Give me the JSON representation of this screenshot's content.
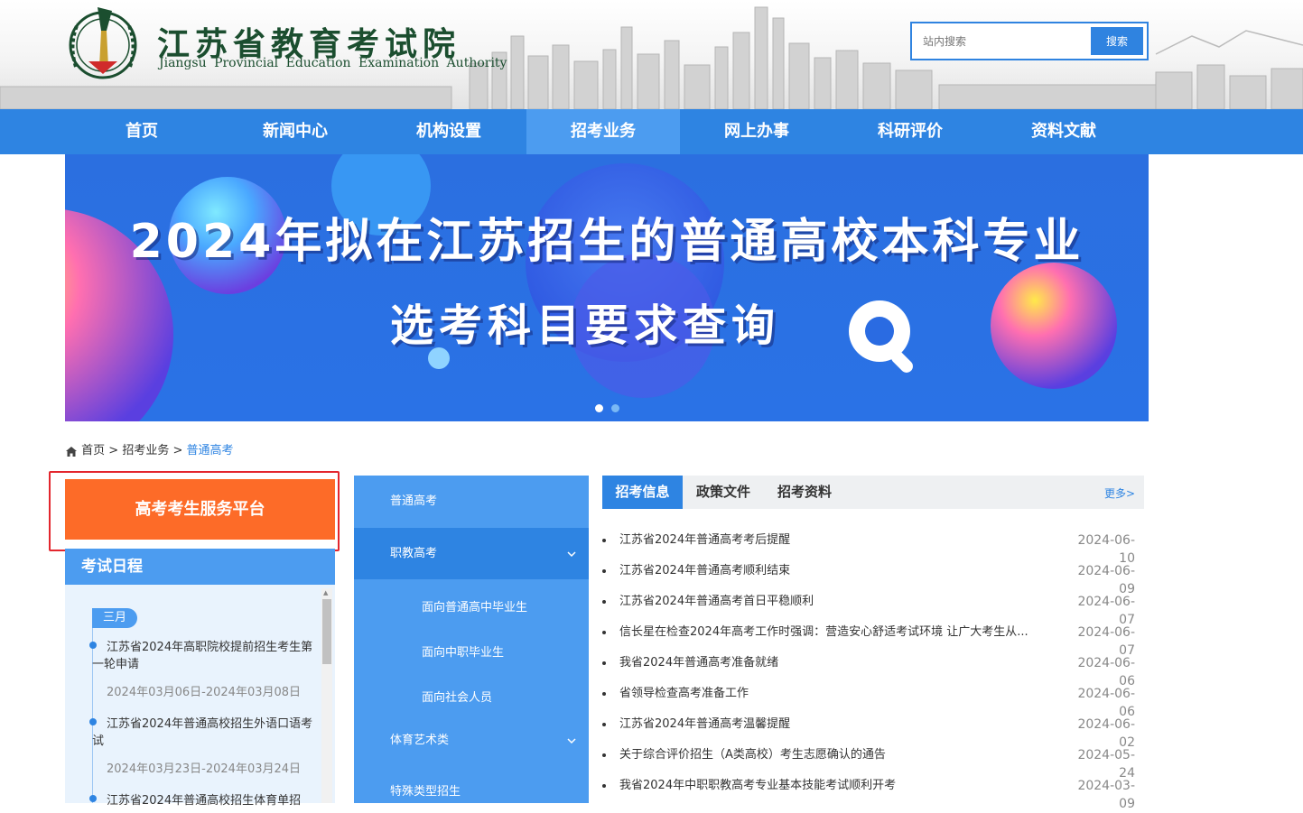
{
  "header": {
    "title": "江苏省教育考试院",
    "subtitle": "Jiangsu Provincial Education Examination Authority",
    "search_placeholder": "站内搜索",
    "search_button": "搜索"
  },
  "nav": {
    "items": [
      "首页",
      "新闻中心",
      "机构设置",
      "招考业务",
      "网上办事",
      "科研评价",
      "资料文献"
    ],
    "active": "招考业务"
  },
  "banner": {
    "line1": "2024年拟在江苏招生的普通高校本科专业",
    "line2": "选考科目要求查询",
    "slide_count": 2,
    "active_slide": 1
  },
  "breadcrumb": {
    "items": [
      "首页",
      "招考业务",
      "普通高考"
    ],
    "separator": ">"
  },
  "left": {
    "platform_button": "高考考生服务平台",
    "schedule_title": "考试日程",
    "month": "三月",
    "events": [
      {
        "title": "江苏省2024年高职院校提前招生考生第一轮申请",
        "date": "2024年03月06日-2024年03月08日"
      },
      {
        "title": "江苏省2024年普通高校招生外语口语考试",
        "date": "2024年03月23日-2024年03月24日"
      },
      {
        "title": "江苏省2024年普通高校招生体育单招",
        "date": ""
      }
    ]
  },
  "middle": {
    "menu": [
      {
        "label": "普通高考"
      },
      {
        "label": "职教高考",
        "expanded": true
      },
      {
        "label": "面向普通高中毕业生"
      },
      {
        "label": "面向中职毕业生"
      },
      {
        "label": "面向社会人员"
      },
      {
        "label": "体育艺术类"
      },
      {
        "label": "特殊类型招生"
      }
    ]
  },
  "right": {
    "tabs": [
      "招考信息",
      "政策文件",
      "招考资料"
    ],
    "active_tab": "招考信息",
    "more": "更多>",
    "news": [
      {
        "title": "江苏省2024年普通高考考后提醒",
        "date": "2024-06-10"
      },
      {
        "title": "江苏省2024年普通高考顺利结束",
        "date": "2024-06-09"
      },
      {
        "title": "江苏省2024年普通高考首日平稳顺利",
        "date": "2024-06-07"
      },
      {
        "title": "信长星在检查2024年高考工作时强调：营造安心舒适考试环境 让广大考生从...",
        "date": "2024-06-07"
      },
      {
        "title": "我省2024年普通高考准备就绪",
        "date": "2024-06-06"
      },
      {
        "title": "省领导检查高考准备工作",
        "date": "2024-06-06"
      },
      {
        "title": "江苏省2024年普通高考温馨提醒",
        "date": "2024-06-02"
      },
      {
        "title": "关于综合评价招生（A类高校）考生志愿确认的通告",
        "date": "2024-05-24"
      },
      {
        "title": "我省2024年中职职教高考专业基本技能考试顺利开考",
        "date": "2024-03-09"
      }
    ]
  },
  "colors": {
    "primary": "#2e84e2",
    "secondary": "#4c9cf0",
    "accent_orange": "#fd6b28",
    "highlight_red": "#e3262d",
    "logo_green": "#1b4e2f"
  }
}
